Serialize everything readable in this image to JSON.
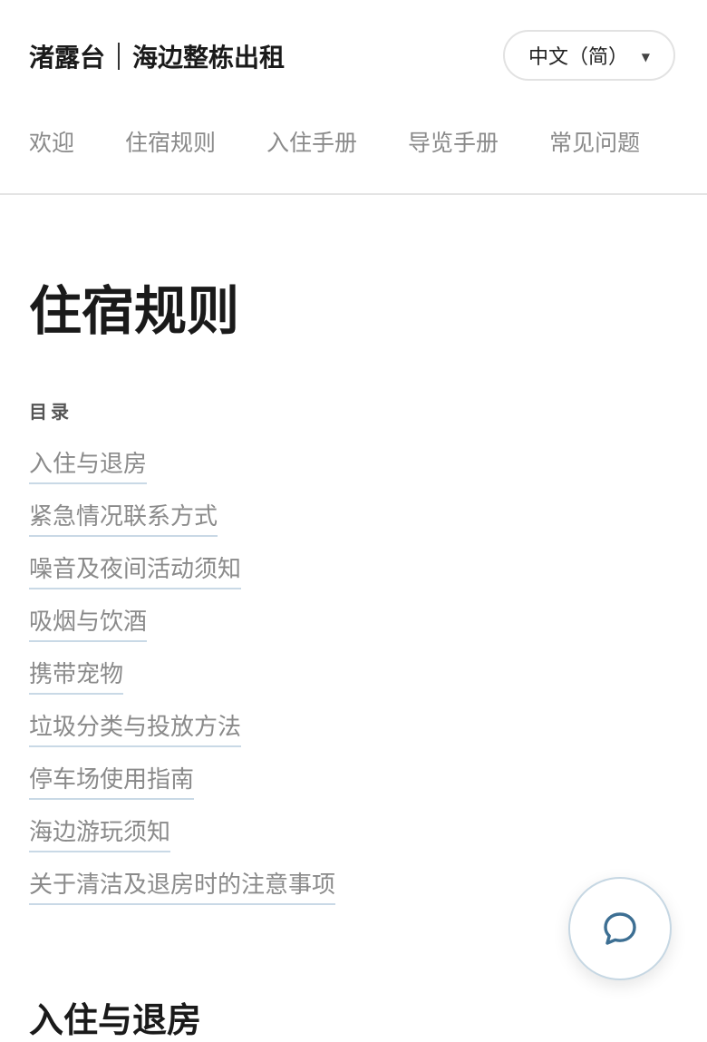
{
  "header": {
    "brand_name": "渚露台",
    "brand_tagline": "海边整栋出租",
    "language_selected": "中文（简）",
    "caret_glyph": "▼"
  },
  "nav": {
    "items": [
      "欢迎",
      "住宿规则",
      "入住手册",
      "导览手册",
      "常见问题"
    ]
  },
  "page": {
    "title": "住宿规则"
  },
  "toc": {
    "label": "目录",
    "items": [
      "入住与退房",
      "紧急情况联系方式",
      "噪音及夜间活动须知",
      "吸烟与饮酒",
      "携带宠物",
      "垃圾分类与投放方法",
      "停车场使用指南",
      "海边游玩须知",
      "关于清洁及退房时的注意事项"
    ]
  },
  "section": {
    "title": "入住与退房"
  },
  "icons": {
    "chat": "chat-bubble-icon",
    "language_caret": "caret-down-icon"
  },
  "colors": {
    "accent": "#3d6f93",
    "link_underline": "#c9d9e6",
    "muted_text": "#8a8a8a"
  }
}
